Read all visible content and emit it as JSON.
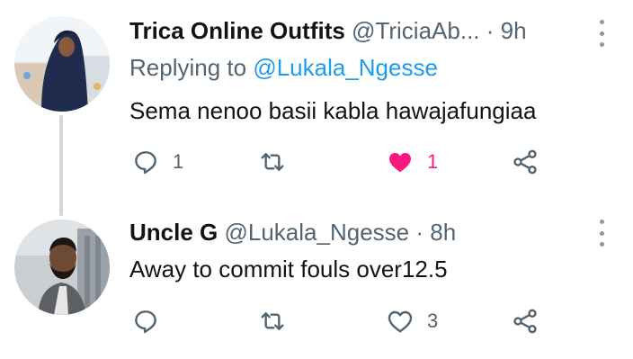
{
  "replies": [
    {
      "display_name": "Trica Online Outfits",
      "handle": "@TriciaAb...",
      "separator": "·",
      "time": "9h",
      "replying_prefix": "Replying to",
      "replying_to": "@Lukala_Ngesse",
      "text": "Sema nenoo basii kabla hawajafungiaa",
      "reply_count": "1",
      "retweet_count": "",
      "like_count": "1",
      "liked": true,
      "avatar_icon": "profile-photo-woman-hijab"
    },
    {
      "display_name": "Uncle G",
      "handle": "@Lukala_Ngesse",
      "separator": "·",
      "time": "8h",
      "text": "Away to commit fouls over12.5",
      "reply_count": "",
      "retweet_count": "",
      "like_count": "3",
      "liked": false,
      "avatar_icon": "profile-photo-bearded-man"
    }
  ],
  "colors": {
    "like_active": "#f91880",
    "link": "#1d9bf0",
    "muted": "#536471",
    "thread_line": "#cfd9de"
  },
  "icons": [
    "reply-icon",
    "retweet-icon",
    "like-icon",
    "share-icon",
    "more-options-icon"
  ]
}
